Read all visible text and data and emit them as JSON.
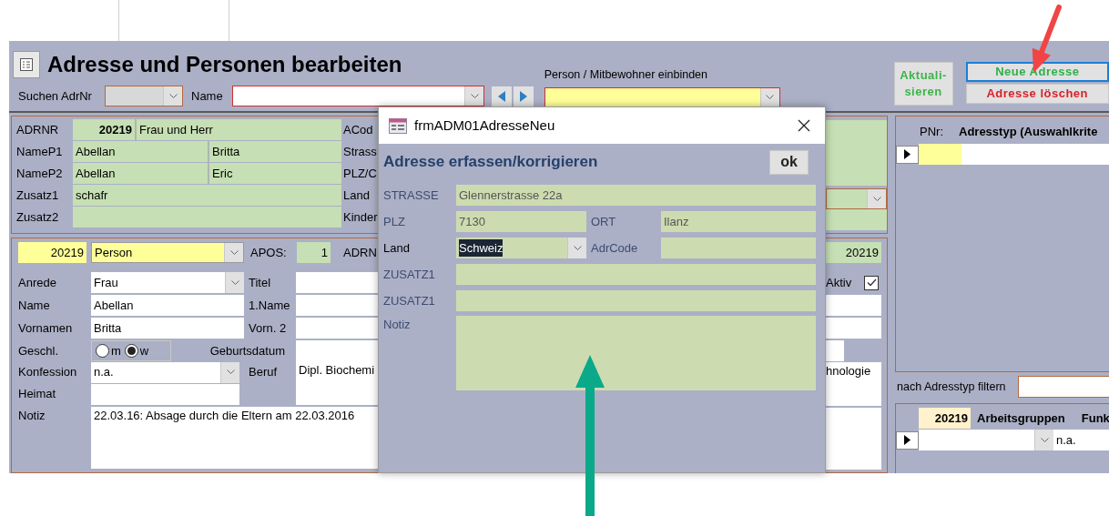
{
  "header": {
    "title": "Adresse und Personen bearbeiten",
    "search_label": "Suchen AdrNr",
    "name_label": "Name",
    "mitbewohner_label": "Person / Mitbewohner einbinden"
  },
  "actions": [
    {
      "kind": "refresh",
      "lines": [
        "Aktuali-",
        "sieren"
      ],
      "focused": false
    },
    {
      "kind": "new",
      "lines": [
        "Neue Adresse"
      ],
      "focused": true
    },
    {
      "kind": "delete",
      "lines": [
        "Adresse löschen"
      ],
      "focused": false
    }
  ],
  "address": {
    "rows": [
      {
        "kind": "id",
        "label": "ADRNR",
        "values": [
          "20219",
          "Frau und Herr"
        ],
        "side_label": "ACod"
      },
      {
        "kind": "pair",
        "label": "NameP1",
        "values": [
          "Abellan",
          "Britta"
        ],
        "side_label": "Strass"
      },
      {
        "kind": "pair",
        "label": "NameP2",
        "values": [
          "Abellan",
          "Eric"
        ],
        "side_label": "PLZ/C"
      },
      {
        "kind": "single",
        "label": "Zusatz1",
        "values": [
          "schafr"
        ],
        "side_label": "Land"
      },
      {
        "kind": "single",
        "label": "Zusatz2",
        "side_label": "Kinder"
      }
    ]
  },
  "person": {
    "id": "20219",
    "type": "Person",
    "apos_label": "APOS:",
    "apos": "1",
    "adrn_label": "ADRN",
    "right_id": "20219",
    "aktiv_label": "Aktiv",
    "aktiv": true,
    "anrede_label": "Anrede",
    "anrede": "Frau",
    "titel_label": "Titel",
    "name_label": "Name",
    "name": "Abellan",
    "name1_label": "1.Name",
    "vornamen_label": "Vornamen",
    "vornamen": "Britta",
    "vorn2_label": "Vorn. 2",
    "geschl_label": "Geschl.",
    "geschlecht": [
      {
        "label": "m",
        "selected": false
      },
      {
        "label": "w",
        "selected": true
      }
    ],
    "geburtsdatum_label": "Geburtsdatum",
    "konfession_label": "Konfession",
    "konfession": "n.a.",
    "beruf_label": "Beruf",
    "beruf": "Dipl. Biochemi",
    "beruf_right": "hnologie",
    "heimat_label": "Heimat",
    "notiz_label": "Notiz",
    "notiz": "22.03.16: Absage durch die Eltern am 22.03.2016"
  },
  "dialog": {
    "window_title": "frmADM01AdresseNeu",
    "heading": "Adresse erfassen/korrigieren",
    "ok": "ok",
    "strasse_label": "STRASSE",
    "strasse": "Glennerstrasse 22a",
    "plz_label": "PLZ",
    "plz": "7130",
    "ort_label": "ORT",
    "ort": "Ilanz",
    "land_label": "Land",
    "land": "Schweiz",
    "land_highlighted": true,
    "adrcode_label": "AdrCode",
    "zusatz_labels": [
      "ZUSATZ1",
      "ZUSATZ1"
    ],
    "notiz_label": "Notiz"
  },
  "adresstyp": {
    "pnr_label": "PNr:",
    "header": "Adresstyp (Auswahlkrite",
    "filter_label": "nach Adresstyp filtern"
  },
  "arbeitsgruppen": {
    "id": "20219",
    "header": "Arbeitsgruppen",
    "header_2": "Funk",
    "funktion": "n.a."
  }
}
